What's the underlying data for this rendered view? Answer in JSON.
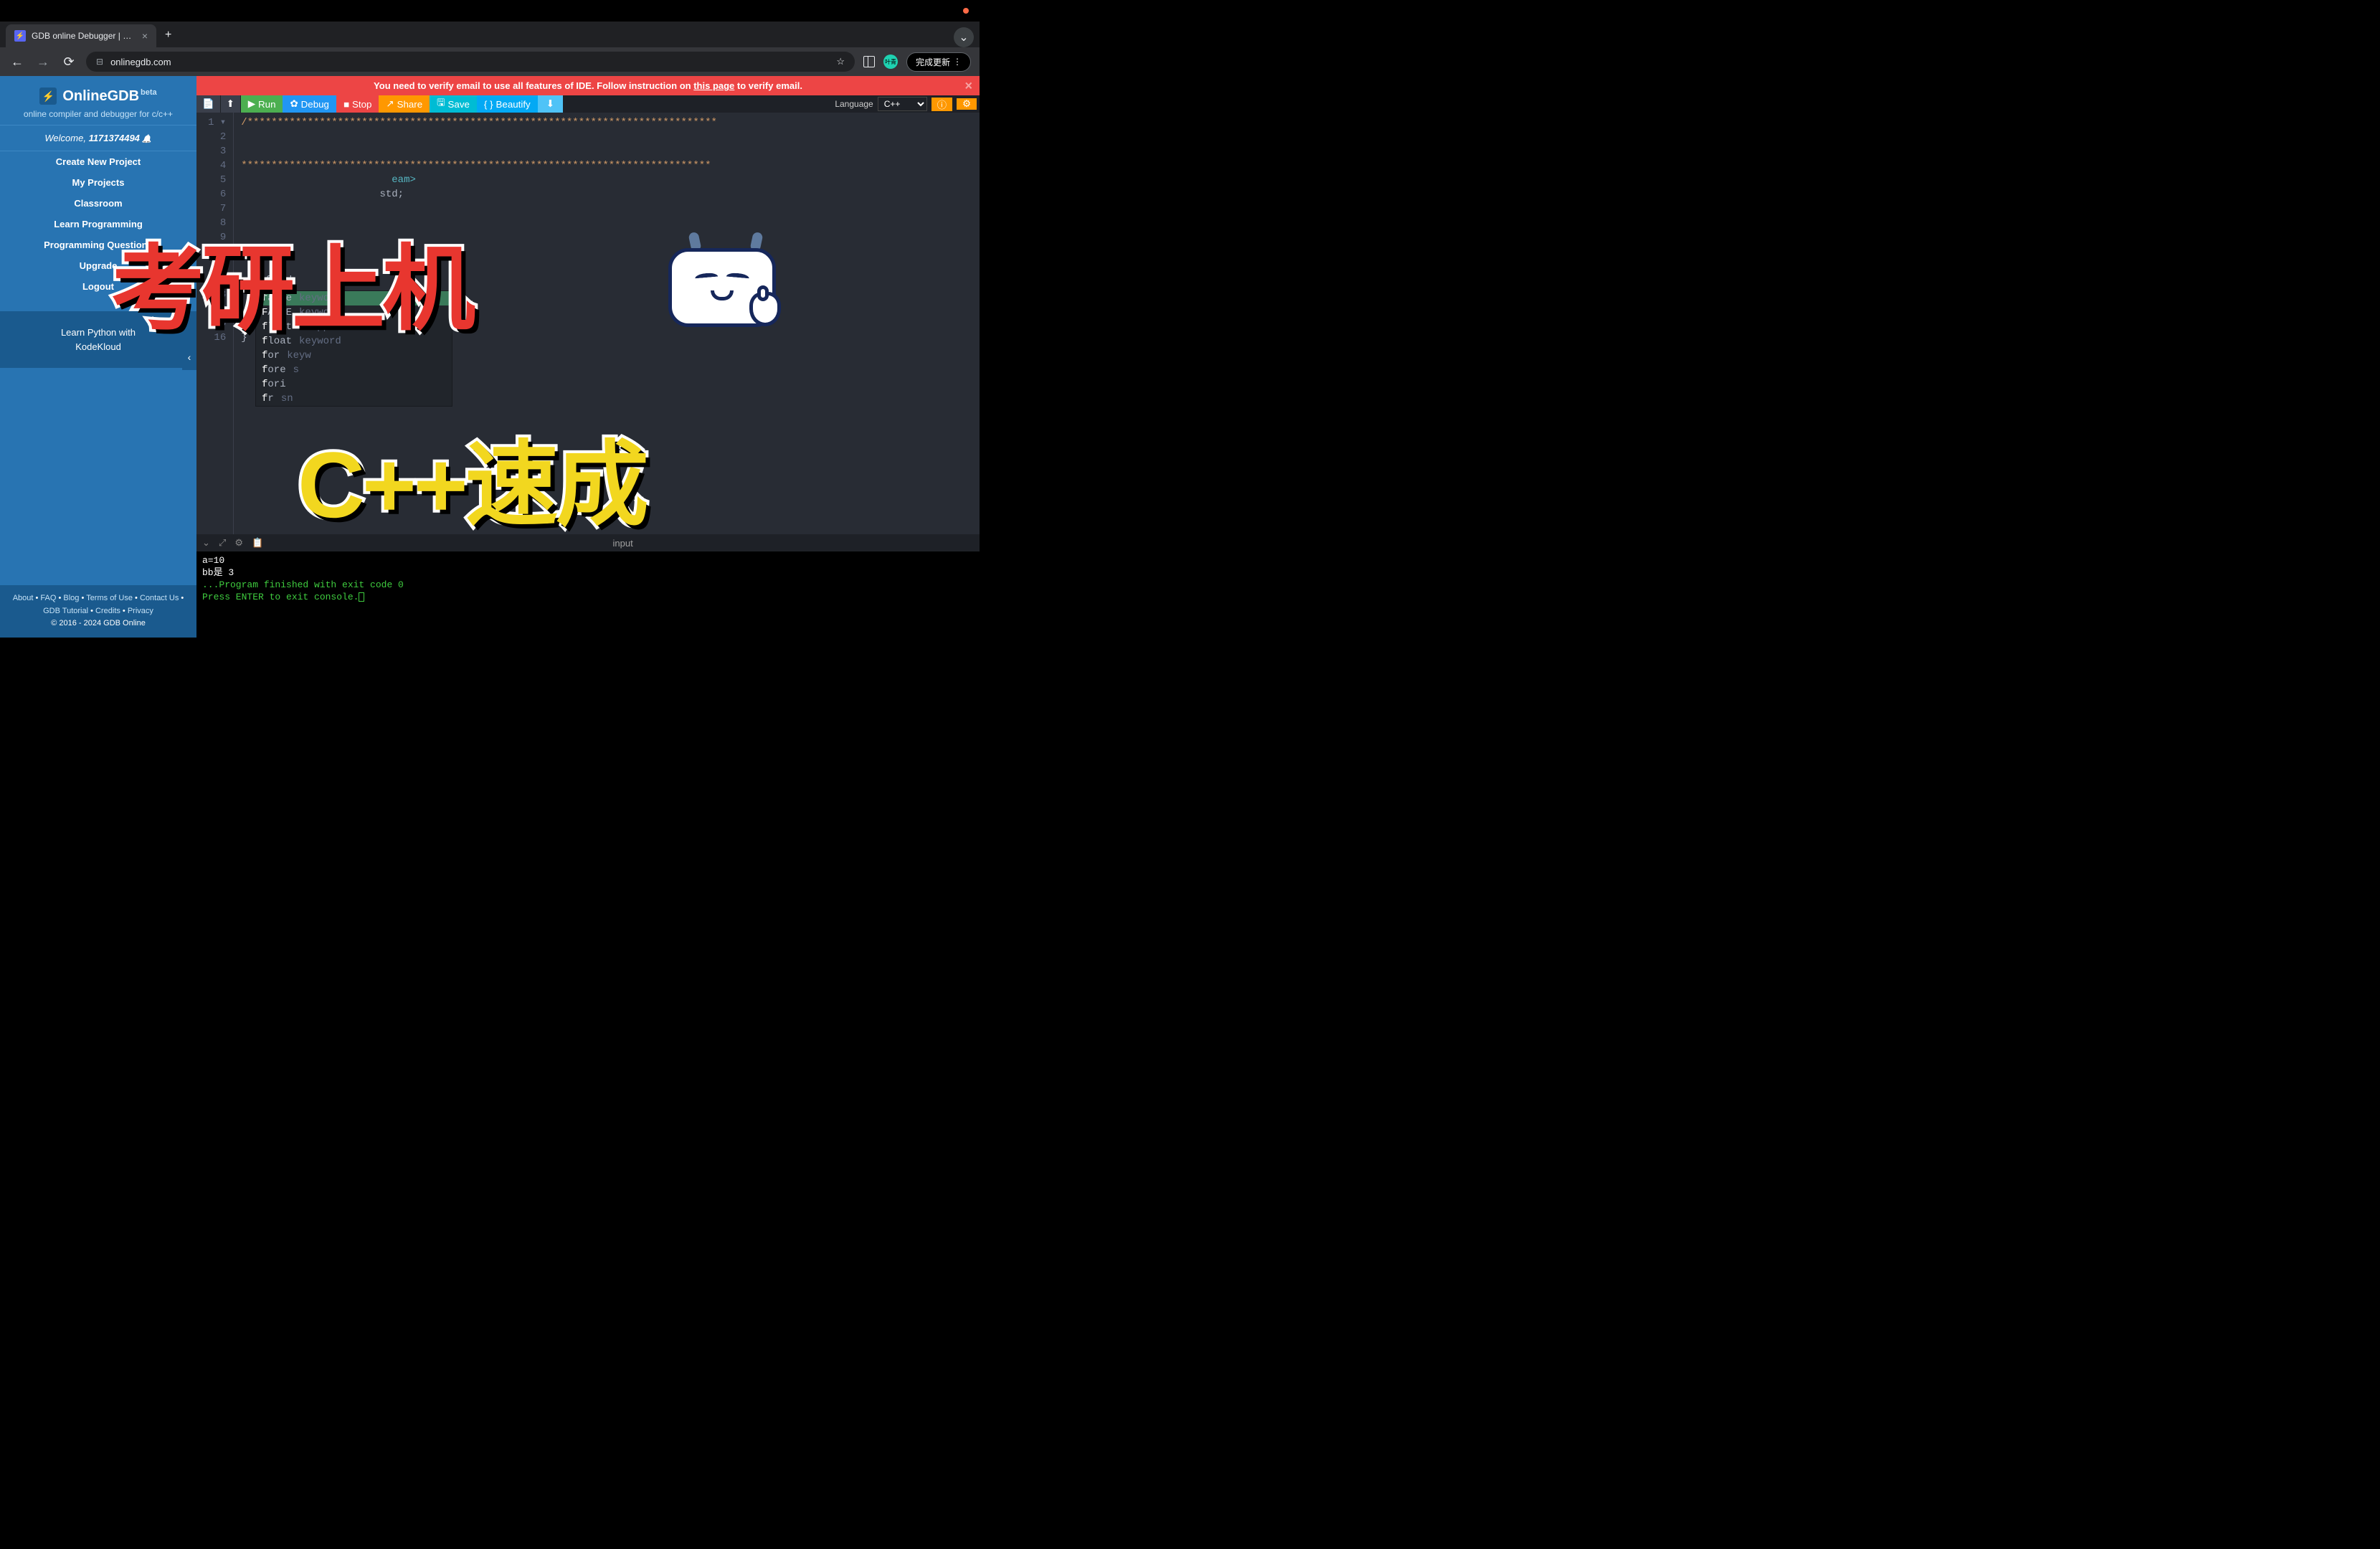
{
  "browser": {
    "tab_title": "GDB online Debugger | Comp",
    "url": "onlinegdb.com",
    "update_label": "完成更新",
    "avatar_initials": "叶青"
  },
  "sidebar": {
    "logo": "OnlineGDB",
    "logo_beta": "beta",
    "tagline": "online compiler and debugger for c/c++",
    "welcome_prefix": "Welcome, ",
    "welcome_user": "1171374494",
    "menu": [
      "Create New Project",
      "My Projects",
      "Classroom",
      "Learn Programming",
      "Programming Questions",
      "Upgrade",
      "Logout"
    ],
    "promo_line1": "Learn Python with",
    "promo_line2": "KodeKloud",
    "footer_links": [
      "About",
      "FAQ",
      "Blog",
      "Terms of Use",
      "Contact Us",
      "GDB Tutorial",
      "Credits",
      "Privacy"
    ],
    "copyright": "© 2016 - 2024 GDB Online"
  },
  "alert": {
    "text_before": "You need to verify email to use all features of IDE. Follow instruction on ",
    "link": "this page",
    "text_after": " to verify email."
  },
  "toolbar": {
    "run": "Run",
    "debug": "Debug",
    "stop": "Stop",
    "share": "Share",
    "save": "Save",
    "beautify": "Beautify",
    "language_label": "Language",
    "language_value": "C++"
  },
  "editor": {
    "visible_code_fragments": {
      "line1_comment": "/******************************************************************************",
      "line4_comment": "******************************************************************************",
      "line5_include_end": "eam>",
      "line6_using": " std;",
      "line12_frag": "f  bb",
      "line16_brace": "}"
    }
  },
  "autocomplete": {
    "items": [
      {
        "match": "f",
        "rest": "alse",
        "type": "keyword",
        "selected": true
      },
      {
        "match": "F",
        "rest": "ALSE",
        "type": "keyword"
      },
      {
        "match": "f",
        "rest": "list",
        "type": "snippet"
      },
      {
        "match": "f",
        "rest": "loat",
        "type": "keyword"
      },
      {
        "match": "f",
        "rest": "or",
        "type": "keyw"
      },
      {
        "match": "f",
        "rest": "ore",
        "type": "s"
      },
      {
        "match": "f",
        "rest": "ori",
        "type": ""
      },
      {
        "match": "f",
        "rest": "r",
        "type": "sn"
      }
    ]
  },
  "console": {
    "label": "input",
    "lines": [
      "a=10",
      "bb是 3",
      "",
      "",
      "...Program finished with exit code 0",
      "Press ENTER to exit console."
    ]
  },
  "overlay": {
    "red_text": "考研上机",
    "yellow_text": "C++速成"
  }
}
